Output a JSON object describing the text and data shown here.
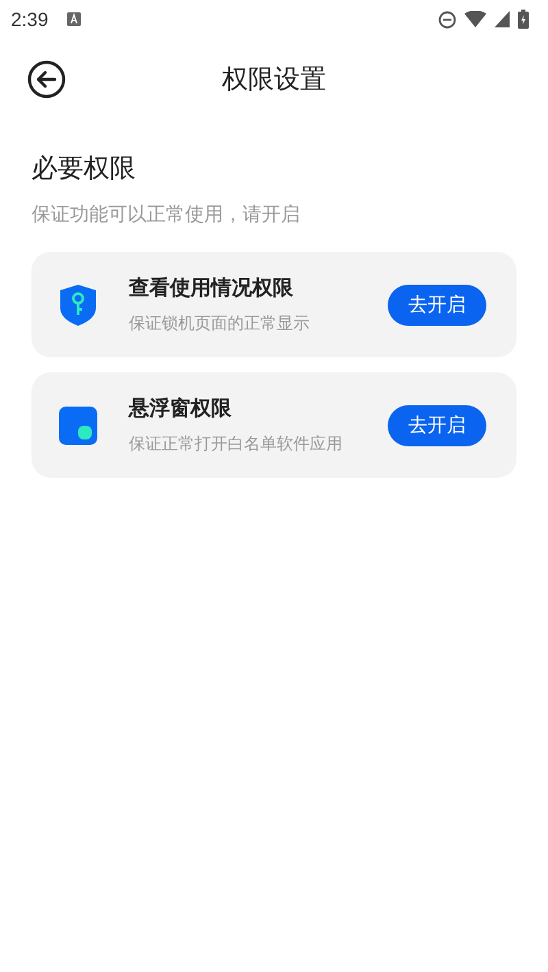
{
  "status_bar": {
    "time": "2:39"
  },
  "header": {
    "title": "权限设置"
  },
  "section": {
    "title": "必要权限",
    "subtitle": "保证功能可以正常使用，请开启"
  },
  "permissions": [
    {
      "kind": "shield",
      "title": "查看使用情况权限",
      "description": "保证锁机页面的正常显示",
      "button": "去开启"
    },
    {
      "kind": "window",
      "title": "悬浮窗权限",
      "description": "保证正常打开白名单软件应用",
      "button": "去开启"
    }
  ]
}
